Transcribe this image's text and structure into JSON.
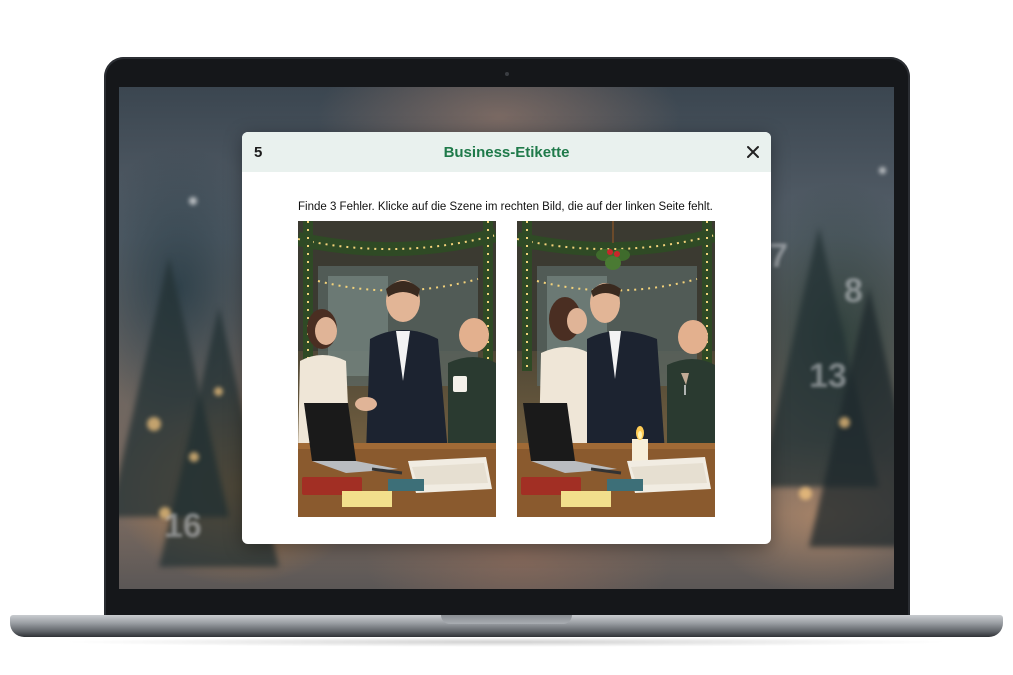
{
  "modal": {
    "number": "5",
    "title": "Business-Etikette",
    "instruction": "Finde 3 Fehler. Klicke auf die Szene im rechten Bild, die auf der linken Seite fehlt.",
    "close_icon": "close-icon"
  },
  "scenes": {
    "left_icon": "office-party-scene-original",
    "right_icon": "office-party-scene-modified"
  },
  "background": {
    "numbers": [
      "7",
      "8",
      "13",
      "16"
    ]
  },
  "colors": {
    "title": "#1f7a4a",
    "header_bg": "#e9f1ee"
  }
}
